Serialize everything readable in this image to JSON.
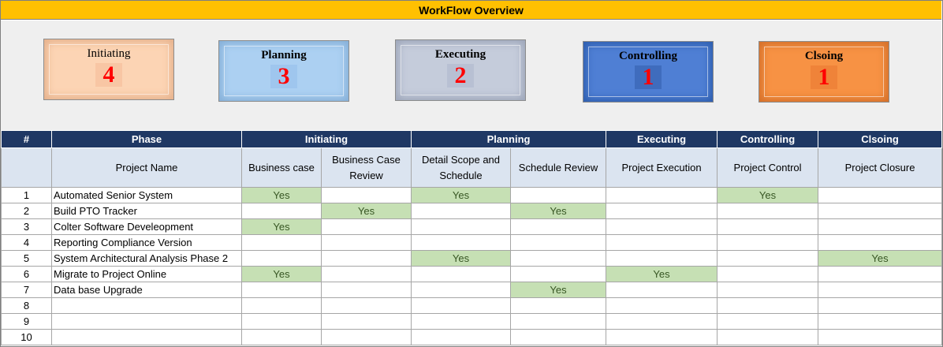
{
  "title": "WorkFlow Overview",
  "cards": [
    {
      "label": "Initiating",
      "count": "4"
    },
    {
      "label": "Planning",
      "count": "3"
    },
    {
      "label": "Executing",
      "count": "2"
    },
    {
      "label": "Controlling",
      "count": "1"
    },
    {
      "label": "Clsoing",
      "count": "1"
    }
  ],
  "table": {
    "hash_header": "#",
    "phase_header": "Phase",
    "phase_groups": [
      "Initiating",
      "Planning",
      "Executing",
      "Controlling",
      "Clsoing"
    ],
    "project_name_header": "Project Name",
    "sub_headers": [
      "Business case",
      "Business Case Review",
      "Detail Scope and Schedule",
      "Schedule Review",
      "Project Execution",
      "Project Control",
      "Project Closure"
    ],
    "rows": [
      {
        "num": "1",
        "name": "Automated Senior System",
        "cells": [
          "Yes",
          "",
          "Yes",
          "",
          "",
          "Yes",
          ""
        ]
      },
      {
        "num": "2",
        "name": "Build PTO Tracker",
        "cells": [
          "",
          "Yes",
          "",
          "Yes",
          "",
          "",
          ""
        ]
      },
      {
        "num": "3",
        "name": "Colter Software Develeopment",
        "cells": [
          "Yes",
          "",
          "",
          "",
          "",
          "",
          ""
        ]
      },
      {
        "num": "4",
        "name": "Reporting Compliance Version",
        "cells": [
          "",
          "",
          "",
          "",
          "",
          "",
          ""
        ]
      },
      {
        "num": "5",
        "name": "System Architectural Analysis Phase 2",
        "cells": [
          "",
          "",
          "Yes",
          "",
          "",
          "",
          "Yes"
        ]
      },
      {
        "num": "6",
        "name": "Migrate to Project Online",
        "cells": [
          "Yes",
          "",
          "",
          "",
          "Yes",
          "",
          ""
        ]
      },
      {
        "num": "7",
        "name": "Data base Upgrade",
        "cells": [
          "",
          "",
          "",
          "Yes",
          "",
          "",
          ""
        ]
      },
      {
        "num": "8",
        "name": "",
        "cells": [
          "",
          "",
          "",
          "",
          "",
          "",
          ""
        ]
      },
      {
        "num": "9",
        "name": "",
        "cells": [
          "",
          "",
          "",
          "",
          "",
          "",
          ""
        ]
      },
      {
        "num": "10",
        "name": "",
        "cells": [
          "",
          "",
          "",
          "",
          "",
          "",
          ""
        ]
      }
    ]
  },
  "colors": {
    "title_bar": "#ffc000",
    "header_dark": "#1f3864",
    "header_light": "#dbe4f0",
    "yes_fill": "#c6e0b4",
    "count_red": "#ff0000"
  }
}
